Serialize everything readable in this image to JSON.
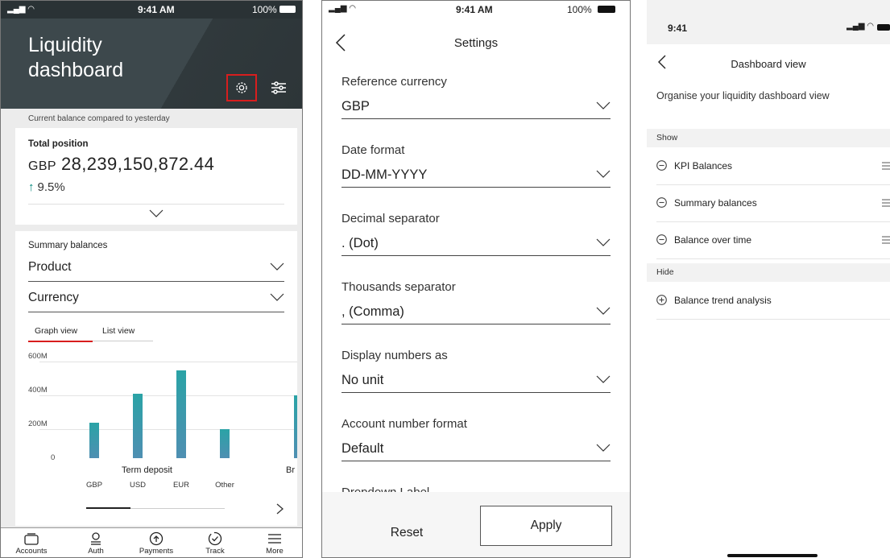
{
  "screen1": {
    "status": {
      "time": "9:41 AM",
      "battery": "100%"
    },
    "title_line1": "Liquidity",
    "title_line2": "dashboard",
    "comparison_text": "Current balance compared to yesterday",
    "total_position": {
      "label": "Total position",
      "currency": "GBP",
      "value": "28,239,150,872.44",
      "change": "9.5%"
    },
    "summary": {
      "label": "Summary balances",
      "select1": "Product",
      "select2": "Currency",
      "tab_graph": "Graph view",
      "tab_list": "List view"
    },
    "chart_data": {
      "type": "bar",
      "y_ticks": [
        "600M",
        "400M",
        "200M",
        "0"
      ],
      "ylim": [
        0,
        600
      ],
      "group_label": "Term deposit",
      "next_group_label": "Br",
      "categories": [
        "GBP",
        "USD",
        "EUR",
        "Other"
      ],
      "values": [
        210,
        380,
        520,
        170
      ],
      "next_group_first_value": 370,
      "color": "#2aa3a6"
    },
    "nav": [
      {
        "label": "Accounts",
        "icon": "accounts-icon"
      },
      {
        "label": "Auth",
        "icon": "auth-icon"
      },
      {
        "label": "Payments",
        "icon": "payments-icon"
      },
      {
        "label": "Track",
        "icon": "track-icon"
      },
      {
        "label": "More",
        "icon": "menu-icon"
      }
    ],
    "highlight_color": "#d81e1e"
  },
  "screen2": {
    "status": {
      "time": "9:41 AM",
      "battery": "100%"
    },
    "title": "Settings",
    "fields": [
      {
        "label": "Reference currency",
        "value": "GBP"
      },
      {
        "label": "Date format",
        "value": "DD-MM-YYYY"
      },
      {
        "label": "Decimal separator",
        "value": ". (Dot)"
      },
      {
        "label": "Thousands separator",
        "value": ", (Comma)"
      },
      {
        "label": "Display numbers as",
        "value": "No unit"
      },
      {
        "label": "Account number format",
        "value": "Default"
      },
      {
        "label": "Dropdown Label",
        "value": ""
      }
    ],
    "reset_label": "Reset",
    "apply_label": "Apply"
  },
  "screen3": {
    "status": {
      "time": "9:41"
    },
    "title": "Dashboard view",
    "subtitle": "Organise your liquidity dashboard view",
    "show_label": "Show",
    "show_items": [
      "KPI Balances",
      "Summary balances",
      "Balance over time"
    ],
    "hide_label": "Hide",
    "hide_items": [
      "Balance trend analysis"
    ]
  }
}
